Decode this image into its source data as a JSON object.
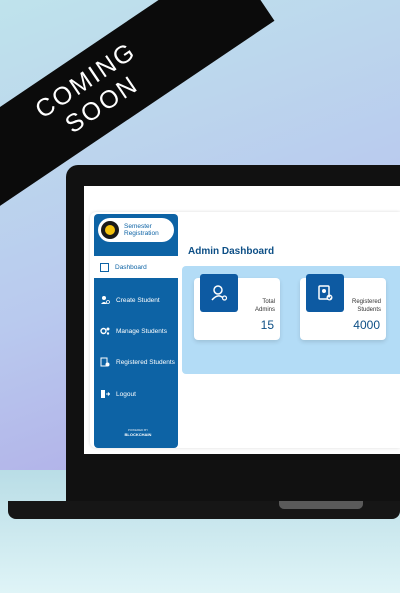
{
  "banner": {
    "line1": "COMING",
    "line2": "SOON"
  },
  "app": {
    "logo_line1": "Semester",
    "logo_line2": "Registration"
  },
  "sidebar": {
    "items": [
      {
        "label": "Dashboard",
        "icon": "dashboard-icon",
        "active": true
      },
      {
        "label": "Create Student",
        "icon": "user-add-icon"
      },
      {
        "label": "Manage Students",
        "icon": "gears-icon"
      },
      {
        "label": "Registered Students",
        "icon": "document-check-icon"
      },
      {
        "label": "Logout",
        "icon": "logout-icon"
      }
    ],
    "powered_label": "POWERED BY",
    "powered_name": "BLOCKCHAIN"
  },
  "main": {
    "title": "Admin Dashboard"
  },
  "stats": [
    {
      "label_line1": "Total",
      "label_line2": "Admins",
      "value": "15",
      "icon": "admin-icon"
    },
    {
      "label_line1": "Registered",
      "label_line2": "Students",
      "value": "4000",
      "icon": "registered-icon"
    }
  ],
  "colors": {
    "brand": "#0d63a5",
    "panel": "#b3dcf6",
    "ribbon": "#0b0b0b"
  }
}
